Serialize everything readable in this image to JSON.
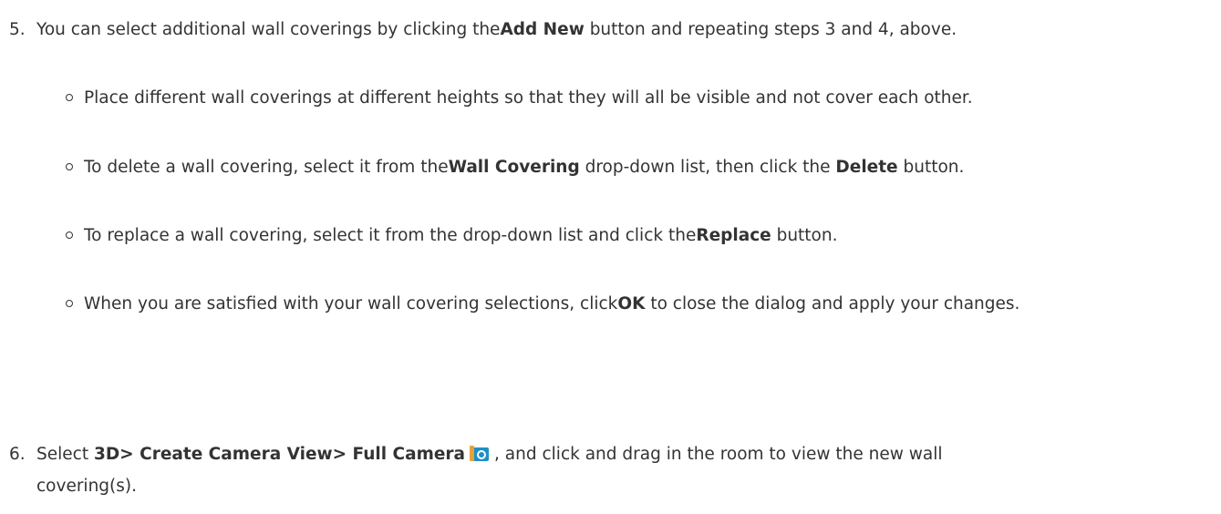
{
  "step5": {
    "number": "5.",
    "text_a": "You can select additional wall coverings by clicking the",
    "bold_a": "Add New",
    "text_b": " button and repeating steps 3 and 4, above."
  },
  "bullets": [
    {
      "text_a": "Place different wall coverings at different heights so that they will all be visible and not cover each other."
    },
    {
      "text_a": "To delete a wall covering, select it from the",
      "bold_a": "Wall Covering",
      "text_b": " drop-down list, then click the ",
      "bold_b": "Delete",
      "text_c": " button."
    },
    {
      "text_a": "To replace a wall covering, select it from the drop-down list and click the",
      "bold_a": "Replace",
      "text_b": " button."
    },
    {
      "text_a": "When you are satisfied with your wall covering selections, click",
      "bold_a": "OK",
      "text_b": " to close the dialog and apply your changes."
    }
  ],
  "step6": {
    "number": "6.",
    "text_a": "Select ",
    "bold_a": "3D> Create Camera View> Full Camera",
    "icon": "camera-icon",
    "text_b": ", and click and drag in the room to view the new wall covering(s)."
  },
  "colors": {
    "text": "#333333",
    "icon_blue": "#1e90c8",
    "icon_orange": "#e8a13a"
  }
}
